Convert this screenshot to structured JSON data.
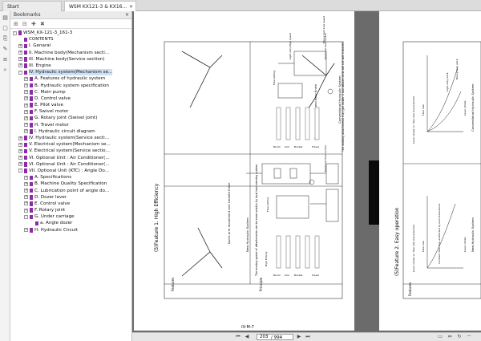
{
  "tabs": {
    "home_label": "Start",
    "doc_label": "WSM KX121-3 & KX16..."
  },
  "bookmarks": {
    "panel_title": "Bookmarks",
    "items": [
      {
        "label": "WSM_KX-121-3_161-3",
        "level": 0,
        "expand": "-"
      },
      {
        "label": "CONTENTS",
        "level": 1,
        "expand": ""
      },
      {
        "label": "I. Genaral",
        "level": 1,
        "expand": "+"
      },
      {
        "label": "II. Machine body(Mechanism secti...",
        "level": 1,
        "expand": "+"
      },
      {
        "label": "III. Machine body(Service section)",
        "level": 1,
        "expand": "+"
      },
      {
        "label": "III. Engine",
        "level": 1,
        "expand": "+"
      },
      {
        "label": "IV. Hydraulic system(Mechanism se...",
        "level": 1,
        "expand": "-",
        "selected": true
      },
      {
        "label": "A. Features of hydraulic system",
        "level": 2,
        "expand": "+"
      },
      {
        "label": "B. Hydraulic system specification",
        "level": 2,
        "expand": "+"
      },
      {
        "label": "C. Main pump",
        "level": 2,
        "expand": "+"
      },
      {
        "label": "D. Control valve",
        "level": 2,
        "expand": "+"
      },
      {
        "label": "E. Pilot valve",
        "level": 2,
        "expand": "+"
      },
      {
        "label": "F. Swivel motor",
        "level": 2,
        "expand": "+"
      },
      {
        "label": "G. Rotary joint (Swivel joint)",
        "level": 2,
        "expand": "+"
      },
      {
        "label": "H. Travel motor",
        "level": 2,
        "expand": "+"
      },
      {
        "label": "I. Hydraulic circuit diagram",
        "level": 2,
        "expand": "+"
      },
      {
        "label": "IV. Hydraulic system(Service secti...",
        "level": 1,
        "expand": "+"
      },
      {
        "label": "V. Electrical system(Mechanism se...",
        "level": 1,
        "expand": "+"
      },
      {
        "label": "V. Electrical system(Service sectio...",
        "level": 1,
        "expand": "+"
      },
      {
        "label": "VI. Optional Unit : Air Conditioner(...",
        "level": 1,
        "expand": "+"
      },
      {
        "label": "VI. Optional Unit : Air Conditioner(...",
        "level": 1,
        "expand": "+"
      },
      {
        "label": "VII. Optional Unit (KTC) : Angle Do...",
        "level": 1,
        "expand": "-"
      },
      {
        "label": "A. Specifications",
        "level": 2,
        "expand": "+"
      },
      {
        "label": "B. Machine Quality Specification",
        "level": 2,
        "expand": "+"
      },
      {
        "label": "C. Lubrication point of angle do...",
        "level": 2,
        "expand": "+"
      },
      {
        "label": "D. Dozer lever",
        "level": 2,
        "expand": "+"
      },
      {
        "label": "E. Control valve",
        "level": 2,
        "expand": "+"
      },
      {
        "label": "F. Rotary joint",
        "level": 2,
        "expand": "+"
      },
      {
        "label": "G. Under carriage",
        "level": 2,
        "expand": "-"
      },
      {
        "label": "a. Angle dozer",
        "level": 3,
        "expand": ""
      },
      {
        "label": "H. Hydraulic Circuit",
        "level": 2,
        "expand": "+"
      }
    ]
  },
  "status": {
    "page_input": "203",
    "page_total": "/ 994"
  },
  "page1": {
    "feature_title": "(5)Feature 1. High Efficiency",
    "page_number": "IV-M-7",
    "col_features": "Features",
    "col_principle": "Principle",
    "new_system": "New Hydraulic System",
    "conventional_system": "Conventional Hydraulic System",
    "new_caption": "Quick arm movement and smooth finish",
    "conv_caption": "Slow arm movement and easy finish",
    "heavy_duty": "Heavy duty Low speed",
    "light_duty": "Light duty High speed",
    "new_row_text": "The moving speed of attachments can be more quickly by dual load sensing system.",
    "conv_row_text": "The working attachments may get slower if two attachments are not well matched.",
    "flow_setting": "Flow setting",
    "high_priority": "High Priority",
    "boom": "Boom",
    "arm": "Arm",
    "bucket": "Bucket",
    "travel": "Travel",
    "pos_flow_control": "Positional flow control"
  },
  "page2": {
    "feature_title": "(5)Feature 2. Easy operation",
    "col_features": "Features",
    "new_system": "New Hydraulic System",
    "conventional_system": "Conventional Hydraulic System",
    "flow_rate": "Flow rate",
    "lever_stroke": "Lever stroke",
    "light_duty_work": "Light-duty work",
    "heavy_duty_work": "Heavy-duty work",
    "const_flow": "Constant flow rate unaffected by load fluctuations",
    "new_caption": "Lever stroke vs. flow rate characteristic",
    "conv_caption": "Lever stroke vs. flow rate characteristic"
  },
  "colors": {
    "bookmark_icon": "#8c2aa8",
    "doc_background": "#6b6b6b",
    "selection": "#cfe0f5"
  }
}
